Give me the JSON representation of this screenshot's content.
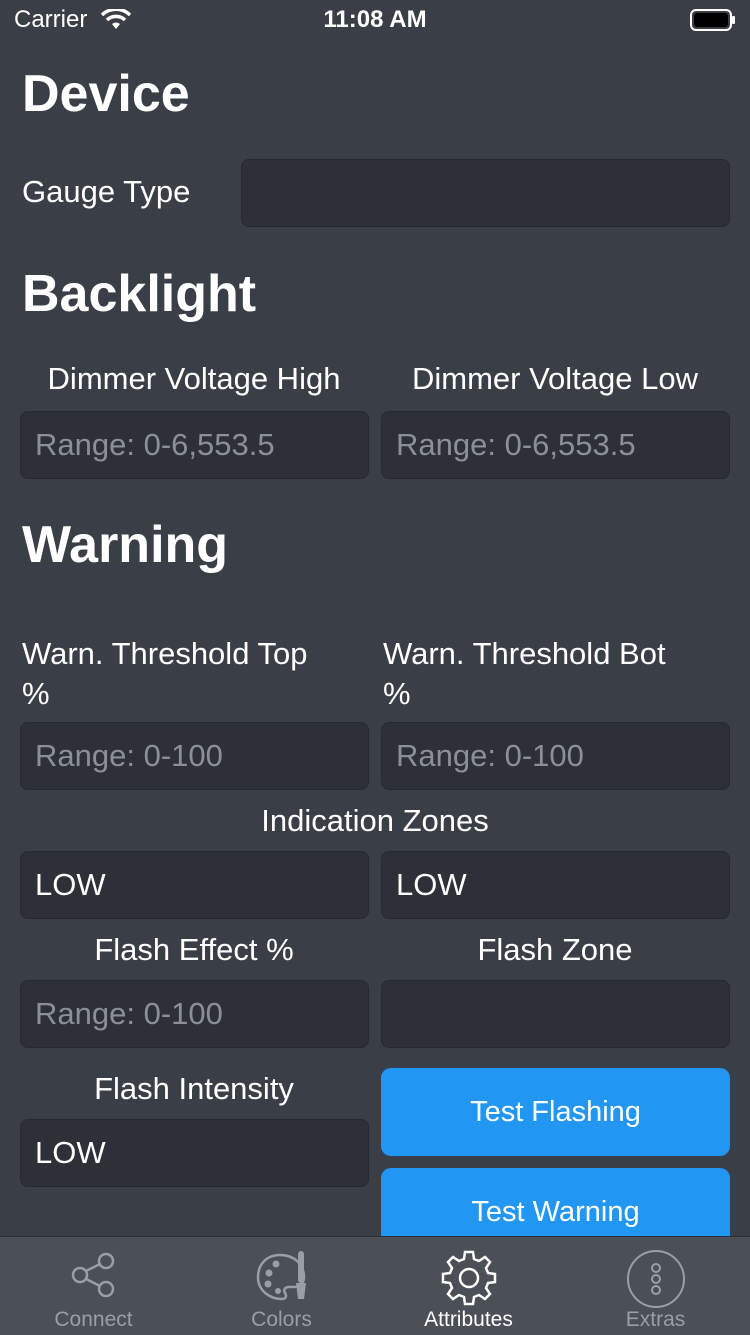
{
  "status": {
    "carrier": "Carrier",
    "time": "11:08 AM"
  },
  "device": {
    "title": "Device",
    "gauge_type_label": "Gauge Type",
    "gauge_type_value": ""
  },
  "backlight": {
    "title": "Backlight",
    "dimmer_high_label": "Dimmer Voltage High",
    "dimmer_low_label": "Dimmer Voltage Low",
    "dimmer_high_placeholder": "Range: 0-6,553.5",
    "dimmer_low_placeholder": "Range: 0-6,553.5"
  },
  "warning": {
    "title": "Warning",
    "thresh_top_label_1": "Warn. Threshold Top",
    "thresh_top_label_2": "%",
    "thresh_bot_label_1": "Warn. Threshold Bot",
    "thresh_bot_label_2": "%",
    "thresh_top_placeholder": "Range: 0-100",
    "thresh_bot_placeholder": "Range: 0-100",
    "indication_zones_label": "Indication Zones",
    "zone_left_value": "LOW",
    "zone_right_value": "LOW",
    "flash_effect_label": "Flash Effect %",
    "flash_effect_placeholder": "Range: 0-100",
    "flash_zone_label": "Flash Zone",
    "flash_zone_value": "",
    "flash_intensity_label": "Flash Intensity",
    "flash_intensity_value": "LOW",
    "test_flashing_label": "Test Flashing",
    "test_warning_label": "Test Warning"
  },
  "tabs": [
    {
      "label": "Connect",
      "icon": "share-icon"
    },
    {
      "label": "Colors",
      "icon": "palette-icon"
    },
    {
      "label": "Attributes",
      "icon": "gear-icon"
    },
    {
      "label": "Extras",
      "icon": "more-icon"
    }
  ],
  "colors": {
    "background": "#3a3f47",
    "field": "#2d3037",
    "accent": "#2196f3",
    "tabbar": "#4a4f58"
  }
}
